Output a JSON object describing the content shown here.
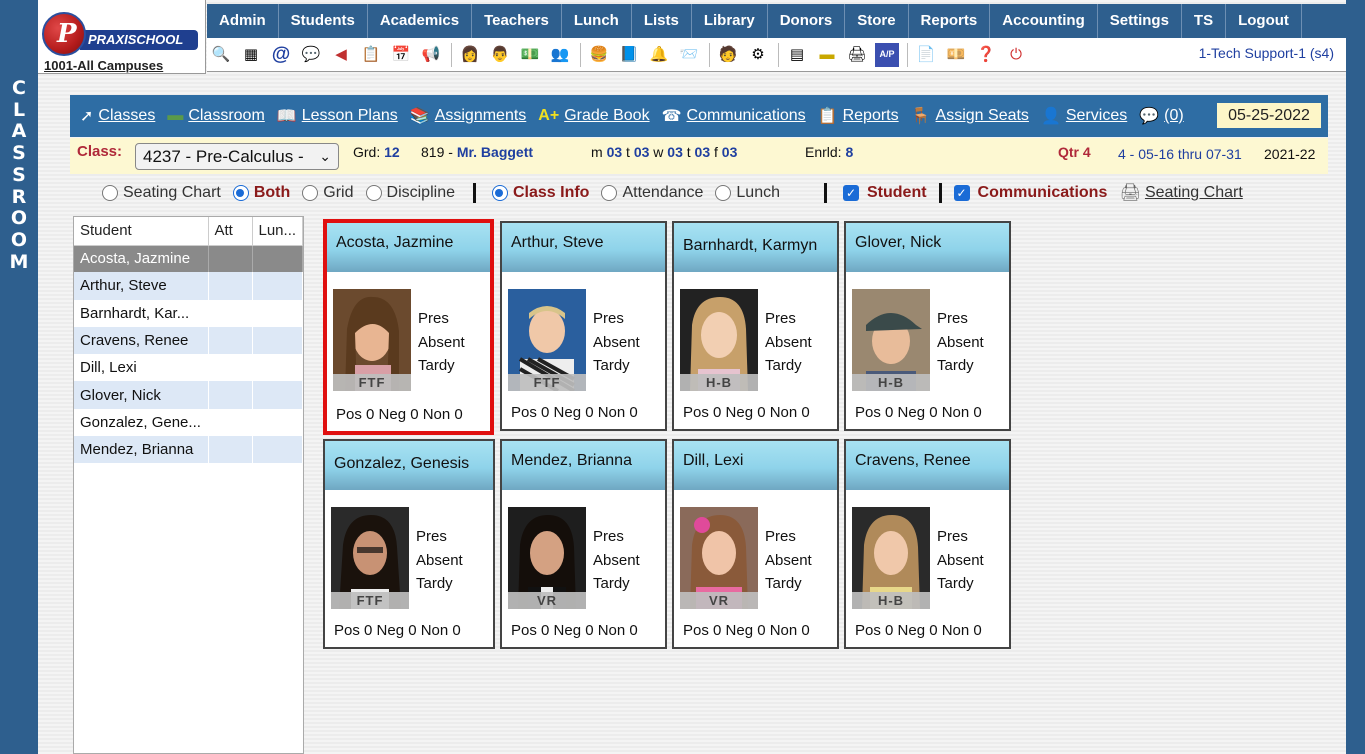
{
  "sidebar_label": [
    "C",
    "L",
    "A",
    "S",
    "S",
    "R",
    "O",
    "O",
    "M"
  ],
  "logo": {
    "wordmark": "PRAXISCHOOL",
    "campus": "1001-All Campuses"
  },
  "top_menu": [
    "Admin",
    "Students",
    "Academics",
    "Teachers",
    "Lunch",
    "Lists",
    "Library",
    "Donors",
    "Store",
    "Reports",
    "Accounting",
    "Settings",
    "TS",
    "Logout"
  ],
  "icon_bar": [
    "search-icon",
    "grid-icon",
    "at-icon",
    "chat-bubbles-icon",
    "megaphone-small-icon",
    "calendar-grid-icon",
    "calendar-icon",
    "megaphone-icon",
    "sep",
    "person-add-icon",
    "person-icon",
    "money-icon",
    "people-icon",
    "sep",
    "hamburger-icon",
    "book-icon",
    "bell-icon",
    "arrow-right-icon",
    "sep",
    "reports-person-icon",
    "gear-person-icon",
    "sep",
    "spreadsheet-icon",
    "card-icon",
    "printer-icon",
    "ap-icon",
    "sep",
    "pdf-icon",
    "cash-icon",
    "help-icon",
    "power-icon"
  ],
  "support_label": "1-Tech Support-1 (s4)",
  "classroom_toolbar": {
    "items": [
      {
        "icon": "pointer-icon",
        "label": "Classes"
      },
      {
        "icon": "blackboard-icon",
        "label": "Classroom"
      },
      {
        "icon": "open-book-icon",
        "label": "Lesson Plans"
      },
      {
        "icon": "books-icon",
        "label": "Assignments"
      },
      {
        "icon": "a-plus-icon",
        "label": "Grade Book"
      },
      {
        "icon": "phone-icon",
        "label": "Communications"
      },
      {
        "icon": "report-icon",
        "label": "Reports"
      },
      {
        "icon": "desk-icon",
        "label": "Assign Seats"
      },
      {
        "icon": "person-services-icon",
        "label": "Services"
      },
      {
        "icon": "message-icon",
        "label": "(0)"
      }
    ],
    "date": "05-25-2022"
  },
  "class_bar": {
    "class_label": "Class:",
    "class_value": "4237 - Pre-Calculus -",
    "grd_label": "Grd:",
    "grd_value": "12",
    "room": "819 -",
    "teacher": "Mr. Baggett",
    "schedule_m_label": "m",
    "schedule_m": "03",
    "schedule_t_label": "t",
    "schedule_t": "03",
    "schedule_w_label": "w",
    "schedule_w": "03",
    "schedule_t2_label": "t",
    "schedule_t2": "03",
    "schedule_f_label": "f",
    "schedule_f": "03",
    "enrld_label": "Enrld:",
    "enrld_value": "8",
    "qtr": "Qtr 4",
    "qtr_range": "4 - 05-16 thru 07-31",
    "year": "2021-22"
  },
  "view_options": {
    "seating_chart": "Seating Chart",
    "both": "Both",
    "grid": "Grid",
    "discipline": "Discipline",
    "class_info": "Class Info",
    "attendance": "Attendance",
    "lunch": "Lunch",
    "student": "Student",
    "communications": "Communications",
    "print_seating": "Seating Chart"
  },
  "student_list": {
    "headers": [
      "Student",
      "Att",
      "Lun..."
    ],
    "rows": [
      {
        "name": "Acosta, Jazmine",
        "att": "",
        "lunch": ""
      },
      {
        "name": "Arthur, Steve",
        "att": "",
        "lunch": ""
      },
      {
        "name": "Barnhardt, Kar...",
        "att": "",
        "lunch": ""
      },
      {
        "name": "Cravens, Renee",
        "att": "",
        "lunch": ""
      },
      {
        "name": "Dill, Lexi",
        "att": "",
        "lunch": ""
      },
      {
        "name": "Glover, Nick",
        "att": "",
        "lunch": ""
      },
      {
        "name": "Gonzalez, Gene...",
        "att": "",
        "lunch": ""
      },
      {
        "name": "Mendez, Brianna",
        "att": "",
        "lunch": ""
      }
    ]
  },
  "cards": [
    {
      "name": "Acosta, Jazmine",
      "tag": "FTF",
      "pres": "Pres",
      "absent": "Absent",
      "tardy": "Tardy",
      "counts": "Pos 0 Neg 0 Non 0"
    },
    {
      "name": "Arthur, Steve",
      "tag": "FTF",
      "pres": "Pres",
      "absent": "Absent",
      "tardy": "Tardy",
      "counts": "Pos 0 Neg 0 Non 0"
    },
    {
      "name": "Barnhardt, Karmyn",
      "tag": "H-B",
      "pres": "Pres",
      "absent": "Absent",
      "tardy": "Tardy",
      "counts": "Pos 0 Neg 0 Non 0"
    },
    {
      "name": "Glover, Nick",
      "tag": "H-B",
      "pres": "Pres",
      "absent": "Absent",
      "tardy": "Tardy",
      "counts": "Pos 0 Neg 0 Non 0"
    },
    {
      "name": "Gonzalez, Genesis",
      "tag": "FTF",
      "pres": "Pres",
      "absent": "Absent",
      "tardy": "Tardy",
      "counts": "Pos 0 Neg 0 Non 0"
    },
    {
      "name": "Mendez, Brianna",
      "tag": "VR",
      "pres": "Pres",
      "absent": "Absent",
      "tardy": "Tardy",
      "counts": "Pos 0 Neg 0 Non 0"
    },
    {
      "name": "Dill, Lexi",
      "tag": "VR",
      "pres": "Pres",
      "absent": "Absent",
      "tardy": "Tardy",
      "counts": "Pos 0 Neg 0 Non 0"
    },
    {
      "name": "Cravens, Renee",
      "tag": "H-B",
      "pres": "Pres",
      "absent": "Absent",
      "tardy": "Tardy",
      "counts": "Pos 0 Neg 0 Non 0"
    }
  ]
}
